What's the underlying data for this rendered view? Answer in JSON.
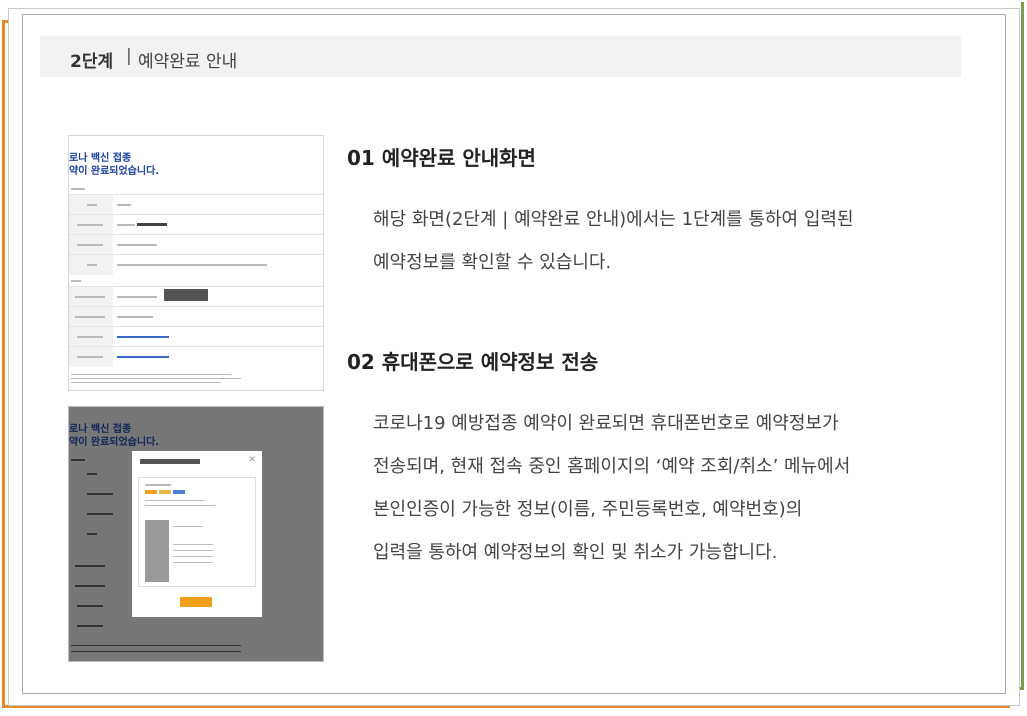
{
  "step": {
    "number": "2단계",
    "separator": "|",
    "title": "예약완료 안내"
  },
  "thumbnail_1": {
    "heading_line1": "로나 백신 접종",
    "heading_line2": "약이 완료되었습니다."
  },
  "thumbnail_2": {
    "heading_line1": "로나 백신 접종",
    "heading_line2": "약이 완료되었습니다."
  },
  "section_1": {
    "heading": "01 예약완료 안내화면",
    "lines": [
      "해당 화면(2단계 | 예약완료 안내)에서는 1단계를 통하여 입력된",
      "예약정보를 확인할 수 있습니다."
    ]
  },
  "section_2": {
    "heading": "02 휴대폰으로 예약정보 전송",
    "lines": [
      "코로나19 예방접종 예약이 완료되면 휴대폰번호로 예약정보가",
      "전송되며, 현재 접속 중인 홈페이지의 ‘예약 조회/취소’ 메뉴에서",
      "본인인증이 가능한 정보(이름, 주민등록번호, 예약번호)의",
      "입력을 통하여 예약정보의 확인 및 취소가 가능합니다."
    ]
  },
  "colors": {
    "frame_orange": "#e8892c",
    "frame_green": "#7e9a52",
    "heading_blue": "#1a3fa0",
    "confirm_orange": "#f2a01c"
  }
}
